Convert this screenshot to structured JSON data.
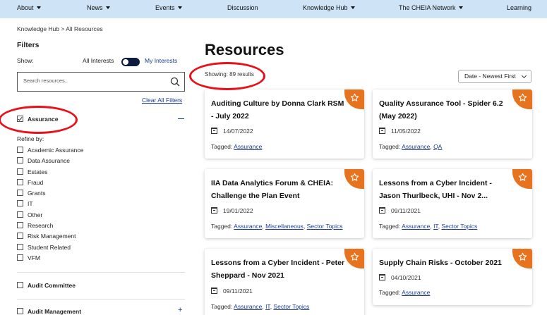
{
  "nav": {
    "items": [
      {
        "label": "About",
        "dropdown": true
      },
      {
        "label": "News",
        "dropdown": true
      },
      {
        "label": "Events",
        "dropdown": true
      },
      {
        "label": "Discussion",
        "dropdown": false
      },
      {
        "label": "Knowledge Hub",
        "dropdown": true
      },
      {
        "label": "The CHEIA Network",
        "dropdown": true
      },
      {
        "label": "Learning",
        "dropdown": false
      }
    ],
    "background": "#cfe3f6"
  },
  "breadcrumb": "Knowledge Hub > All Resources",
  "sidebar": {
    "filters_title": "Filters",
    "show_label": "Show:",
    "all_interests": "All Interests",
    "my_interests": "My Interests",
    "search_placeholder": "Search resources..",
    "clear_all": "Clear All Filters",
    "assurance": {
      "label": "Assurance",
      "checked": true
    },
    "refine_by": "Refine by:",
    "sub_items": [
      "Academic Assurance",
      "Data Assurance",
      "Estates",
      "Fraud",
      "Grants",
      "IT",
      "Other",
      "Research",
      "Risk Management",
      "Student Related",
      "VFM"
    ],
    "sections": [
      {
        "label": "Audit Committee"
      },
      {
        "label": "Audit Management",
        "expandable": true
      }
    ]
  },
  "main": {
    "title": "Resources",
    "showing": "Showing: 89 results",
    "sort": "Date - Newest First",
    "cards": [
      {
        "title": "Auditing Culture by Donna Clark RSM - July 2022",
        "date": "14/07/2022",
        "tagged_label": "Tagged:",
        "tags": [
          "Assurance"
        ]
      },
      {
        "title": "Quality Assurance Tool - Spider 6.2 (May 2022)",
        "date": "11/05/2022",
        "tagged_label": "Tagged:",
        "tags": [
          "Assurance",
          "QA"
        ]
      },
      {
        "title": "IIA Data Analytics Forum & CHEIA: Challenge the Plan Event",
        "date": "19/01/2022",
        "tagged_label": "Tagged:",
        "tags": [
          "Assurance",
          "Miscellaneous",
          "Sector Topics"
        ]
      },
      {
        "title": "Lessons from a Cyber Incident - Jason Thurlbeck, UHI - Nov 2...",
        "date": "09/11/2021",
        "tagged_label": "Tagged:",
        "tags": [
          "Assurance",
          "IT",
          "Sector Topics"
        ]
      },
      {
        "title": "Lessons from a Cyber Incident - Peter Sheppard - Nov 2021",
        "date": "09/11/2021",
        "tagged_label": "Tagged:",
        "tags": [
          "Assurance",
          "IT",
          "Sector Topics"
        ]
      },
      {
        "title": "Supply Chain Risks - October 2021",
        "date": "04/10/2021",
        "tagged_label": "Tagged:",
        "tags": [
          "Assurance"
        ]
      }
    ],
    "accent_color": "#e8731e",
    "link_color": "#1a3c8c"
  },
  "annotations": {
    "color": "#e8101a"
  }
}
